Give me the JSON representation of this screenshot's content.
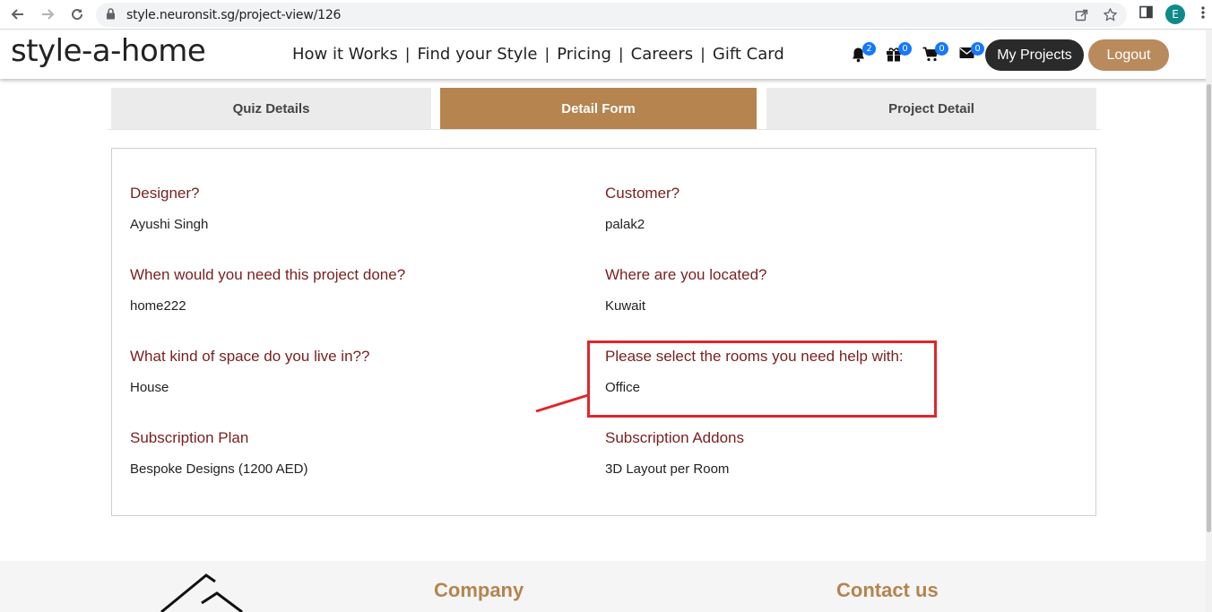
{
  "browser": {
    "url": "style.neuronsit.sg/project-view/126",
    "profile_initial": "E"
  },
  "header": {
    "logo": "style-a-home",
    "nav": [
      "How it Works",
      "Find your Style",
      "Pricing",
      "Careers",
      "Gift Card"
    ],
    "separator": "|",
    "badges": {
      "notifications": "2",
      "gifts": "0",
      "cart": "0",
      "messages": "0"
    },
    "my_projects_label": "My Projects",
    "logout_label": "Logout"
  },
  "tabs": [
    {
      "label": "Quiz Details",
      "active": false
    },
    {
      "label": "Detail Form",
      "active": true
    },
    {
      "label": "Project Detail",
      "active": false
    }
  ],
  "details": {
    "designer_q": "Designer?",
    "designer_a": "Ayushi Singh",
    "customer_q": "Customer?",
    "customer_a": "palak2",
    "when_q": "When would you need this project done?",
    "when_a": "home222",
    "where_q": "Where are you located?",
    "where_a": "Kuwait",
    "space_q": "What kind of space do you live in??",
    "space_a": "House",
    "rooms_q": "Please select the rooms you need help with:",
    "rooms_a": "Office",
    "plan_q": "Subscription Plan",
    "plan_a": "Bespoke Designs (1200 AED)",
    "addons_q": "Subscription Addons",
    "addons_a": "3D Layout per Room"
  },
  "footer": {
    "company_heading": "Company",
    "contact_heading": "Contact us"
  },
  "colors": {
    "accent": "#b5844f",
    "question": "#7a1f1f",
    "annotation": "#e0262b",
    "badge": "#1677ff"
  }
}
